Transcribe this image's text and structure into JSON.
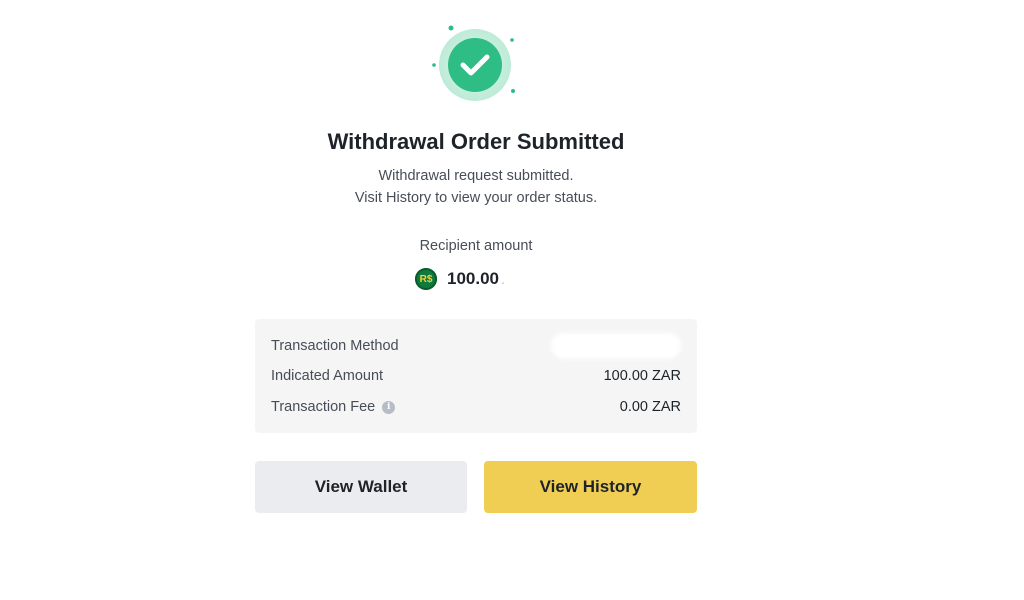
{
  "header": {
    "title": "Withdrawal Order Submitted",
    "subtitle_line1": "Withdrawal request submitted.",
    "subtitle_line2": "Visit History to view your order status."
  },
  "recipient": {
    "label": "Recipient amount",
    "currency_icon_text": "R$",
    "amount": "100.00",
    "trailing": "."
  },
  "details": [
    {
      "label": "Transaction Method",
      "value": ""
    },
    {
      "label": "Indicated Amount",
      "value": "100.00 ZAR"
    },
    {
      "label": "Transaction Fee",
      "value": "0.00 ZAR"
    }
  ],
  "buttons": {
    "view_wallet": "View Wallet",
    "view_history": "View History"
  },
  "colors": {
    "success_green": "#2ebd85",
    "primary_yellow": "#f0cd53",
    "secondary_gray": "#eaecef"
  },
  "icons": {
    "success": "check-circle-icon",
    "currency": "rand-coin-icon",
    "info": "info-icon"
  }
}
